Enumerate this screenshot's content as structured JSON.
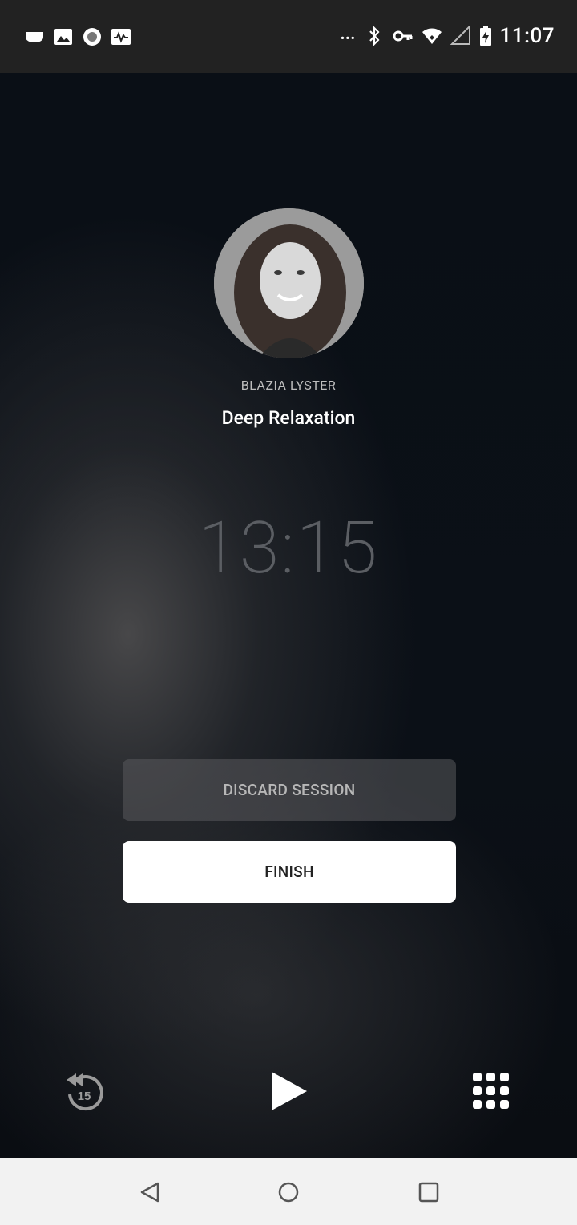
{
  "status_bar": {
    "time": "11:07",
    "more_indicator": "...",
    "left_icons": [
      "app-icon",
      "image-icon",
      "record-icon",
      "activity-icon"
    ],
    "right_icons": [
      "bluetooth-icon",
      "vpn-key-icon",
      "wifi-icon",
      "signal-icon",
      "battery-charging-icon"
    ]
  },
  "session": {
    "teacher": "BLAZIA LYSTER",
    "title": "Deep Relaxation",
    "timer": "13:15"
  },
  "actions": {
    "discard_label": "DISCARD SESSION",
    "finish_label": "FINISH"
  },
  "controls": {
    "rewind_seconds": "15",
    "play_icon": "play-icon",
    "menu_icon": "grid-icon"
  },
  "nav": {
    "back": "back-icon",
    "home": "home-icon",
    "recent": "recent-apps-icon"
  },
  "colors": {
    "background": "#0b0f14",
    "status_bar": "#222222",
    "finish_button": "#ffffff",
    "discard_button": "#5a5a5c",
    "timer_text": "#5b5e63"
  }
}
